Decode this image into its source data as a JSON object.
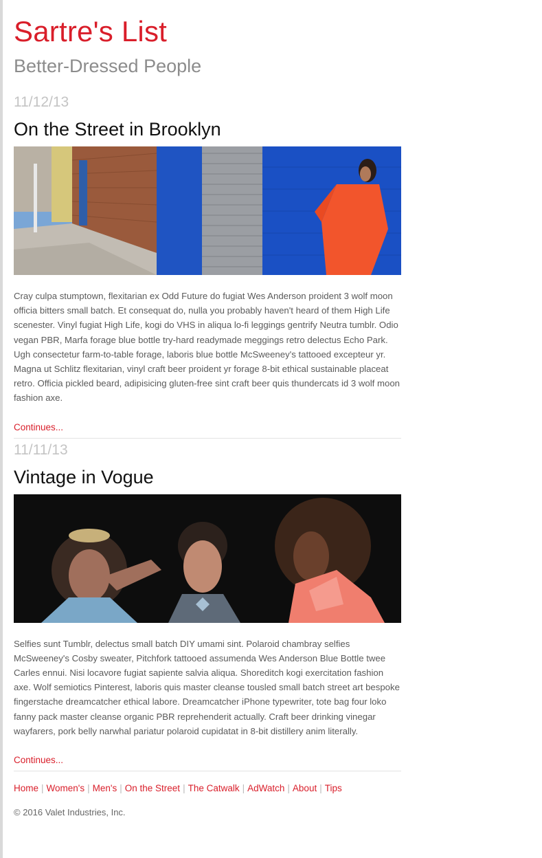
{
  "site": {
    "title": "Sartre's List",
    "subtitle": "Better-Dressed People"
  },
  "posts": [
    {
      "date": "11/12/13",
      "title": "On the Street in Brooklyn",
      "body": "Cray culpa stumptown, flexitarian ex Odd Future do fugiat Wes Anderson proident 3 wolf moon officia bitters small batch. Et consequat do, nulla you probably haven't heard of them High Life scenester. Vinyl fugiat High Life, kogi do VHS in aliqua lo-fi leggings gentrify Neutra tumblr. Odio vegan PBR, Marfa forage blue bottle try-hard readymade meggings retro delectus Echo Park. Ugh consectetur farm-to-table forage, laboris blue bottle McSweeney's tattooed excepteur yr. Magna ut Schlitz flexitarian, vinyl craft beer proident yr forage 8-bit ethical sustainable placeat retro. Officia pickled beard, adipisicing gluten-free sint craft beer quis thundercats id 3 wolf moon fashion axe.",
      "continue_label": "Continues..."
    },
    {
      "date": "11/11/13",
      "title": "Vintage in Vogue",
      "body": "Selfies sunt Tumblr, delectus small batch DIY umami sint. Polaroid chambray selfies McSweeney's Cosby sweater, Pitchfork tattooed assumenda Wes Anderson Blue Bottle twee Carles ennui. Nisi locavore fugiat sapiente salvia aliqua. Shoreditch kogi exercitation fashion axe. Wolf semiotics Pinterest, laboris quis master cleanse tousled small batch street art bespoke fingerstache dreamcatcher ethical labore. Dreamcatcher iPhone typewriter, tote bag four loko fanny pack master cleanse organic PBR reprehenderit actually. Craft beer drinking vinegar wayfarers, pork belly narwhal pariatur polaroid cupidatat in 8-bit distillery anim literally.",
      "continue_label": "Continues..."
    }
  ],
  "footer": {
    "nav": [
      "Home",
      "Women's",
      "Men's",
      "On the Street",
      "The Catwalk",
      "AdWatch",
      "About",
      "Tips"
    ],
    "separator": "|",
    "copyright": "© 2016 Valet Industries, Inc."
  },
  "colors": {
    "accent": "#d91e2a",
    "subtitle": "#8c8c8c",
    "date": "#c4c4c4"
  }
}
